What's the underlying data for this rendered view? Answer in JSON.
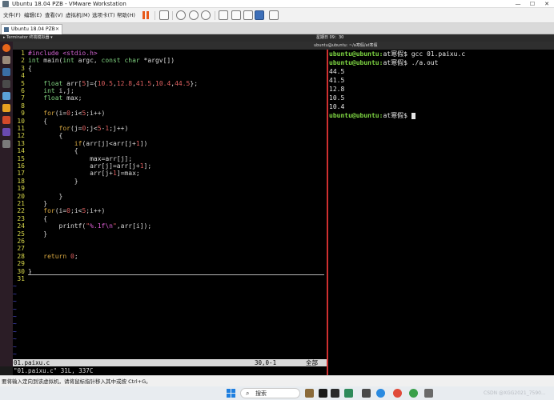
{
  "window": {
    "title": "Ubuntu 18.04 PZB - VMware Workstation",
    "controls": [
      "—",
      "☐",
      "✕"
    ]
  },
  "menubar": {
    "items": [
      "文件(F)",
      "编辑(E)",
      "查看(V)",
      "虚拟机(M)",
      "选项卡(T)",
      "帮助(H)"
    ]
  },
  "vm_tab": {
    "label": "Ubuntu 18.04 PZB"
  },
  "ubuntu_panel": {
    "activities": "▸ Terminator 终端模拟器 ▾",
    "clock": "星期日 09：30"
  },
  "terminal": {
    "title": "ubuntu@ubuntu: ~/a寒假/at寒假"
  },
  "vim": {
    "lines": [
      {
        "n": "1",
        "segs": [
          {
            "t": "#include <stdio.h>",
            "c": "kw-pp"
          }
        ]
      },
      {
        "n": "2",
        "segs": [
          {
            "t": "int",
            "c": "kw-ty"
          },
          {
            "t": " main("
          },
          {
            "t": "int",
            "c": "kw-ty"
          },
          {
            "t": " argc, "
          },
          {
            "t": "const",
            "c": "kw-ty"
          },
          {
            "t": " "
          },
          {
            "t": "char",
            "c": "kw-ty"
          },
          {
            "t": " *argv[])"
          }
        ]
      },
      {
        "n": "3",
        "segs": [
          {
            "t": "{"
          }
        ]
      },
      {
        "n": "4",
        "segs": []
      },
      {
        "n": "5",
        "segs": [
          {
            "t": "    "
          },
          {
            "t": "float",
            "c": "kw-ty"
          },
          {
            "t": " arr["
          },
          {
            "t": "5",
            "c": "num"
          },
          {
            "t": "]={"
          },
          {
            "t": "10.5",
            "c": "num"
          },
          {
            "t": ","
          },
          {
            "t": "12.8",
            "c": "num"
          },
          {
            "t": ","
          },
          {
            "t": "41.5",
            "c": "num"
          },
          {
            "t": ","
          },
          {
            "t": "10.4",
            "c": "num"
          },
          {
            "t": ","
          },
          {
            "t": "44.5",
            "c": "num"
          },
          {
            "t": "};"
          }
        ]
      },
      {
        "n": "6",
        "segs": [
          {
            "t": "    "
          },
          {
            "t": "int",
            "c": "kw-ty"
          },
          {
            "t": " i,j;"
          }
        ]
      },
      {
        "n": "7",
        "segs": [
          {
            "t": "    "
          },
          {
            "t": "float",
            "c": "kw-ty"
          },
          {
            "t": " max;"
          }
        ]
      },
      {
        "n": "8",
        "segs": []
      },
      {
        "n": "9",
        "segs": [
          {
            "t": "    "
          },
          {
            "t": "for",
            "c": "kw-st"
          },
          {
            "t": "(i="
          },
          {
            "t": "0",
            "c": "num"
          },
          {
            "t": ";i<"
          },
          {
            "t": "5",
            "c": "num"
          },
          {
            "t": ";i++)"
          }
        ]
      },
      {
        "n": "10",
        "segs": [
          {
            "t": "    {"
          }
        ]
      },
      {
        "n": "11",
        "segs": [
          {
            "t": "        "
          },
          {
            "t": "for",
            "c": "kw-st"
          },
          {
            "t": "(j="
          },
          {
            "t": "0",
            "c": "num"
          },
          {
            "t": ";j<"
          },
          {
            "t": "5",
            "c": "num"
          },
          {
            "t": "-"
          },
          {
            "t": "1",
            "c": "num"
          },
          {
            "t": ";j++)"
          }
        ]
      },
      {
        "n": "12",
        "segs": [
          {
            "t": "        {"
          }
        ]
      },
      {
        "n": "13",
        "segs": [
          {
            "t": "            "
          },
          {
            "t": "if",
            "c": "kw-st"
          },
          {
            "t": "(arr[j]<arr[j+"
          },
          {
            "t": "1",
            "c": "num"
          },
          {
            "t": "])"
          }
        ]
      },
      {
        "n": "14",
        "segs": [
          {
            "t": "            {"
          }
        ]
      },
      {
        "n": "15",
        "segs": [
          {
            "t": "                max=arr[j];"
          }
        ]
      },
      {
        "n": "16",
        "segs": [
          {
            "t": "                arr[j]=arr[j+"
          },
          {
            "t": "1",
            "c": "num"
          },
          {
            "t": "];"
          }
        ]
      },
      {
        "n": "17",
        "segs": [
          {
            "t": "                arr[j+"
          },
          {
            "t": "1",
            "c": "num"
          },
          {
            "t": "]=max;"
          }
        ]
      },
      {
        "n": "18",
        "segs": [
          {
            "t": "            }"
          }
        ]
      },
      {
        "n": "19",
        "segs": []
      },
      {
        "n": "20",
        "segs": [
          {
            "t": "        }"
          }
        ]
      },
      {
        "n": "21",
        "segs": [
          {
            "t": "    }"
          }
        ]
      },
      {
        "n": "22",
        "segs": [
          {
            "t": "    "
          },
          {
            "t": "for",
            "c": "kw-st"
          },
          {
            "t": "(i="
          },
          {
            "t": "0",
            "c": "num"
          },
          {
            "t": ";i<"
          },
          {
            "t": "5",
            "c": "num"
          },
          {
            "t": ";i++)"
          }
        ]
      },
      {
        "n": "23",
        "segs": [
          {
            "t": "    {"
          }
        ]
      },
      {
        "n": "24",
        "segs": [
          {
            "t": "        printf("
          },
          {
            "t": "\"",
            "c": "str"
          },
          {
            "t": "%.1f\\n",
            "c": "fmt"
          },
          {
            "t": "\"",
            "c": "str"
          },
          {
            "t": ",arr[i]);"
          }
        ]
      },
      {
        "n": "25",
        "segs": [
          {
            "t": "    }"
          }
        ]
      },
      {
        "n": "26",
        "segs": []
      },
      {
        "n": "27",
        "segs": []
      },
      {
        "n": "28",
        "segs": [
          {
            "t": "    "
          },
          {
            "t": "return",
            "c": "kw-st"
          },
          {
            "t": " "
          },
          {
            "t": "0",
            "c": "num"
          },
          {
            "t": ";"
          }
        ]
      },
      {
        "n": "29",
        "segs": []
      },
      {
        "n": "30",
        "segs": [
          {
            "t": "}"
          }
        ]
      },
      {
        "n": "31",
        "segs": []
      }
    ],
    "tilde": "~",
    "status": {
      "file": "01.paixu.c",
      "pos": "30,0-1",
      "scroll": "全部"
    },
    "cmdline": "\"01.paixu.c\" 31L, 337C"
  },
  "shell": {
    "lines": [
      {
        "prompt": "ubuntu@ubuntu:",
        "rest": "at寒假$ gcc 01.paixu.c"
      },
      {
        "prompt": "ubuntu@ubuntu:",
        "rest": "at寒假$ ./a.out"
      },
      {
        "prompt": "",
        "rest": "44.5"
      },
      {
        "prompt": "",
        "rest": "41.5"
      },
      {
        "prompt": "",
        "rest": "12.8"
      },
      {
        "prompt": "",
        "rest": "10.5"
      },
      {
        "prompt": "",
        "rest": "10.4"
      },
      {
        "prompt": "ubuntu@ubuntu:",
        "rest": "at寒假$ "
      }
    ]
  },
  "hint": "要将输入定向到该虚拟机，请将鼠标指针移入其中或按 Ctrl+G。",
  "taskbar": {
    "search_label": "搜索",
    "watermark": "CSDN @XGG2021_7590..."
  },
  "colors": {
    "prompt": "#7fd843",
    "divider": "#cf3030",
    "dock": "#2b1d26"
  }
}
